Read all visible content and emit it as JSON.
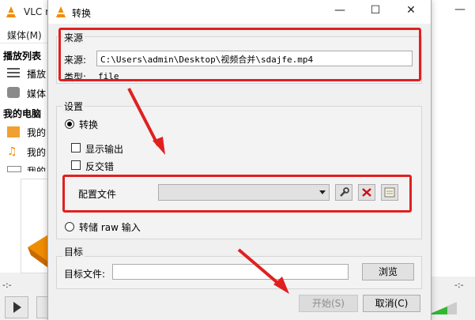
{
  "background_app": {
    "title": "VLC m",
    "menu": "媒体(M)",
    "sidebar": {
      "playlist_header": "播放列表",
      "items_playlist": [
        "播放",
        "媒体"
      ],
      "computer_header": "我的电脑",
      "items_computer": [
        "我的",
        "我的",
        "我的"
      ]
    },
    "time_left": "-:-",
    "time_right": "-:-"
  },
  "dialog": {
    "title": "转换",
    "source": {
      "group_title": "来源",
      "label": "来源:",
      "path": "C:\\Users\\admin\\Desktop\\视频合并\\sdajfe.mp4",
      "type_label": "类型:",
      "type_value": "file"
    },
    "settings": {
      "group_title": "设置",
      "convert_label": "转换",
      "show_output_label": "显示输出",
      "deinterlace_label": "反交错",
      "profile_label": "配置文件",
      "profile_value": "",
      "dump_raw_label": "转储 raw 输入"
    },
    "destination": {
      "group_title": "目标",
      "file_label": "目标文件:",
      "file_value": "",
      "browse_label": "浏览"
    },
    "buttons": {
      "start_label": "开始(S)",
      "cancel_label": "取消(C)"
    }
  },
  "colors": {
    "highlight": "#e02020",
    "vlc_orange": "#f08c00"
  },
  "icons": [
    "vlc-cone-icon",
    "wrench-icon",
    "delete-x-icon",
    "new-profile-icon"
  ]
}
